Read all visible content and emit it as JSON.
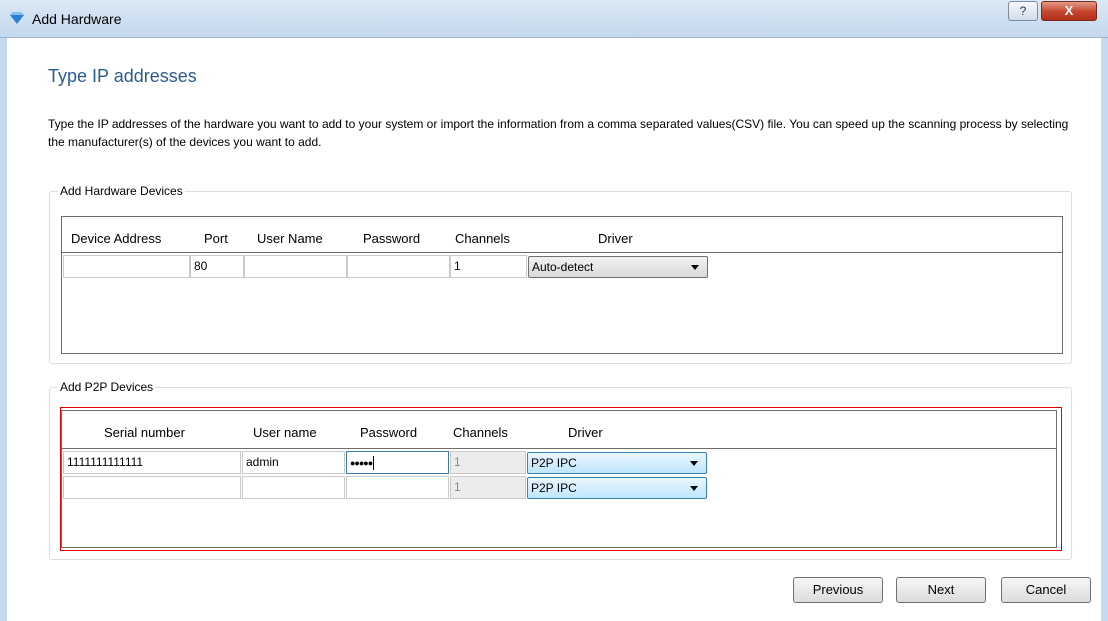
{
  "window": {
    "title": "Add Hardware",
    "help_label": "?",
    "close_label": "X"
  },
  "page": {
    "title": "Type IP addresses",
    "intro": "Type the IP addresses of the hardware you want to add to your system or import the information from a comma separated values(CSV) file. You can speed up the scanning process by selecting the manufacturer(s) of the devices you want to add."
  },
  "hardware": {
    "legend": "Add Hardware Devices",
    "headers": {
      "address": "Device Address",
      "port": "Port",
      "user": "User Name",
      "password": "Password",
      "channels": "Channels",
      "driver": "Driver"
    },
    "row": {
      "address": "",
      "port": "80",
      "user": "",
      "password": "",
      "channels": "1",
      "driver": "Auto-detect"
    }
  },
  "p2p": {
    "legend": "Add P2P Devices",
    "headers": {
      "serial": "Serial number",
      "user": "User name",
      "password": "Password",
      "channels": "Channels",
      "driver": "Driver"
    },
    "rows": [
      {
        "serial": "1111111111111",
        "user": "admin",
        "password": "●●●●●",
        "channels": "1",
        "driver": "P2P IPC"
      },
      {
        "serial": "",
        "user": "",
        "password": "",
        "channels": "1",
        "driver": "P2P IPC"
      }
    ]
  },
  "buttons": {
    "previous": "Previous",
    "next": "Next",
    "cancel": "Cancel"
  },
  "colors": {
    "title_blue": "#2c5c8f",
    "highlight_red": "#e60000",
    "titlebar": "#c4d8ee"
  }
}
